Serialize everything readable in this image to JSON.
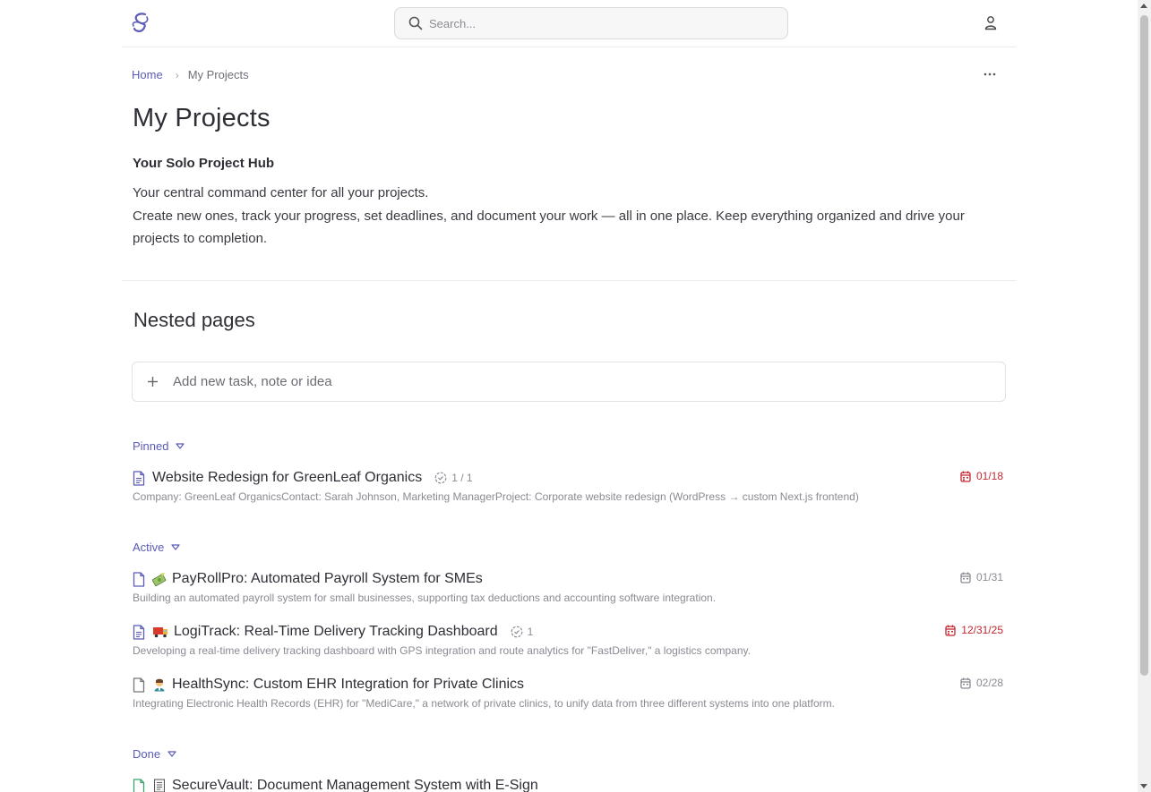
{
  "header": {
    "search_placeholder": "Search...",
    "icons": [
      "app-logo-icon",
      "search-icon",
      "user-icon"
    ]
  },
  "breadcrumb": {
    "home": "Home",
    "current": "My Projects"
  },
  "page": {
    "title": "My Projects",
    "subtitle": "Your Solo Project Hub",
    "description_line1": "Your central command center for all your projects.",
    "description_line2": "Create new ones, track your progress, set deadlines, and document your work — all in one place. Keep everything organized and drive your projects to completion."
  },
  "nested": {
    "title": "Nested pages",
    "add_placeholder": "Add new task, note or idea"
  },
  "groups": {
    "pinned": {
      "label": "Pinned",
      "items": [
        {
          "title": "Website Redesign for GreenLeaf Organics",
          "progress": "1 / 1",
          "date": "01/18",
          "desc": "Company: GreenLeaf OrganicsContact: Sarah Johnson, Marketing ManagerProject: Corporate website redesign (WordPress → custom Next.js frontend)"
        }
      ]
    },
    "active": {
      "label": "Active",
      "items": [
        {
          "emoji": "money-emoji",
          "title": "PayRollPro: Automated Payroll System for SMEs",
          "date": "01/31",
          "desc": "Building an automated payroll system for small businesses, supporting tax deductions and accounting software integration."
        },
        {
          "emoji": "truck-emoji",
          "title": "LogiTrack: Real-Time Delivery Tracking Dashboard",
          "progress": "1",
          "date": "12/31/25",
          "desc": "Developing a real-time delivery tracking dashboard with GPS integration and route analytics for \"FastDeliver,\" a logistics company."
        },
        {
          "emoji": "health-worker-emoji",
          "title": "HealthSync: Custom EHR Integration for Private Clinics",
          "date": "02/28",
          "desc": "Integrating Electronic Health Records (EHR) for \"MediCare,\" a network of private clinics, to unify data from three different systems into one platform."
        }
      ]
    },
    "done": {
      "label": "Done",
      "items": [
        {
          "emoji": "document-emoji",
          "title": "SecureVault: Document Management System with E-Sign"
        }
      ]
    }
  },
  "colors": {
    "accent": "#5b5bb8",
    "overdue": "#c2262e",
    "done": "#3aa36f",
    "muted": "#8a8a93"
  }
}
